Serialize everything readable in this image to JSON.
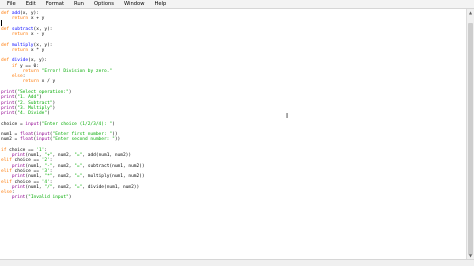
{
  "menu": [
    "File",
    "Edit",
    "Format",
    "Run",
    "Options",
    "Window",
    "Help"
  ],
  "code_lines": [
    [
      [
        "kw",
        "def "
      ],
      [
        "def",
        "add"
      ],
      [
        "txt",
        "(x, y):"
      ]
    ],
    [
      [
        "txt",
        "    "
      ],
      [
        "kw",
        "return"
      ],
      [
        "txt",
        " x + y"
      ]
    ],
    [],
    [
      [
        "kw",
        "def "
      ],
      [
        "def",
        "subtract"
      ],
      [
        "txt",
        "(x, y):"
      ]
    ],
    [
      [
        "txt",
        "    "
      ],
      [
        "kw",
        "return"
      ],
      [
        "txt",
        " x - y"
      ]
    ],
    [],
    [
      [
        "kw",
        "def "
      ],
      [
        "def",
        "multiply"
      ],
      [
        "txt",
        "(x, y):"
      ]
    ],
    [
      [
        "txt",
        "    "
      ],
      [
        "kw",
        "return"
      ],
      [
        "txt",
        " x * y"
      ]
    ],
    [],
    [
      [
        "kw",
        "def "
      ],
      [
        "def",
        "divide"
      ],
      [
        "txt",
        "(x, y):"
      ]
    ],
    [
      [
        "txt",
        "    "
      ],
      [
        "kw",
        "if"
      ],
      [
        "txt",
        " y == 0:"
      ]
    ],
    [
      [
        "txt",
        "        "
      ],
      [
        "kw",
        "return"
      ],
      [
        "txt",
        " "
      ],
      [
        "str",
        "\"Error! Division by zero.\""
      ]
    ],
    [
      [
        "txt",
        "    "
      ],
      [
        "kw",
        "else"
      ],
      [
        "txt",
        ":"
      ]
    ],
    [
      [
        "txt",
        "        "
      ],
      [
        "kw",
        "return"
      ],
      [
        "txt",
        " x / y"
      ]
    ],
    [],
    [
      [
        "bi",
        "print"
      ],
      [
        "txt",
        "("
      ],
      [
        "str",
        "\"Select operation:\""
      ],
      [
        "txt",
        ")"
      ]
    ],
    [
      [
        "bi",
        "print"
      ],
      [
        "txt",
        "("
      ],
      [
        "str",
        "\"1. Add\""
      ],
      [
        "txt",
        ")"
      ]
    ],
    [
      [
        "bi",
        "print"
      ],
      [
        "txt",
        "("
      ],
      [
        "str",
        "\"2. Subtract\""
      ],
      [
        "txt",
        ")"
      ]
    ],
    [
      [
        "bi",
        "print"
      ],
      [
        "txt",
        "("
      ],
      [
        "str",
        "\"3. Multiply\""
      ],
      [
        "txt",
        ")"
      ]
    ],
    [
      [
        "bi",
        "print"
      ],
      [
        "txt",
        "("
      ],
      [
        "str",
        "\"4. Divide\""
      ],
      [
        "txt",
        ")"
      ]
    ],
    [],
    [
      [
        "txt",
        "choice = "
      ],
      [
        "bi",
        "input"
      ],
      [
        "txt",
        "("
      ],
      [
        "str",
        "\"Enter choice (1/2/3/4): \""
      ],
      [
        "txt",
        ")"
      ]
    ],
    [],
    [
      [
        "txt",
        "num1 = "
      ],
      [
        "bi",
        "float"
      ],
      [
        "txt",
        "("
      ],
      [
        "bi",
        "input"
      ],
      [
        "txt",
        "("
      ],
      [
        "str",
        "\"Enter first number: \""
      ],
      [
        "txt",
        "))"
      ]
    ],
    [
      [
        "txt",
        "num2 = "
      ],
      [
        "bi",
        "float"
      ],
      [
        "txt",
        "("
      ],
      [
        "bi",
        "input"
      ],
      [
        "txt",
        "("
      ],
      [
        "str",
        "\"Enter second number: \""
      ],
      [
        "txt",
        "))"
      ]
    ],
    [],
    [
      [
        "kw",
        "if"
      ],
      [
        "txt",
        " choice == "
      ],
      [
        "str",
        "'1'"
      ],
      [
        "txt",
        ":"
      ]
    ],
    [
      [
        "txt",
        "    "
      ],
      [
        "bi",
        "print"
      ],
      [
        "txt",
        "(num1, "
      ],
      [
        "str",
        "\"+\""
      ],
      [
        "txt",
        ", num2, "
      ],
      [
        "str",
        "\"=\""
      ],
      [
        "txt",
        ", add(num1, num2))"
      ]
    ],
    [
      [
        "kw",
        "elif"
      ],
      [
        "txt",
        " choice == "
      ],
      [
        "str",
        "'2'"
      ],
      [
        "txt",
        ":"
      ]
    ],
    [
      [
        "txt",
        "    "
      ],
      [
        "bi",
        "print"
      ],
      [
        "txt",
        "(num1, "
      ],
      [
        "str",
        "\"-\""
      ],
      [
        "txt",
        ", num2, "
      ],
      [
        "str",
        "\"=\""
      ],
      [
        "txt",
        ", subtract(num1, num2))"
      ]
    ],
    [
      [
        "kw",
        "elif"
      ],
      [
        "txt",
        " choice == "
      ],
      [
        "str",
        "'3'"
      ],
      [
        "txt",
        ":"
      ]
    ],
    [
      [
        "txt",
        "    "
      ],
      [
        "bi",
        "print"
      ],
      [
        "txt",
        "(num1, "
      ],
      [
        "str",
        "\"*\""
      ],
      [
        "txt",
        ", num2, "
      ],
      [
        "str",
        "\"=\""
      ],
      [
        "txt",
        ", multiply(num1, num2))"
      ]
    ],
    [
      [
        "kw",
        "elif"
      ],
      [
        "txt",
        " choice == "
      ],
      [
        "str",
        "'4'"
      ],
      [
        "txt",
        ":"
      ]
    ],
    [
      [
        "txt",
        "    "
      ],
      [
        "bi",
        "print"
      ],
      [
        "txt",
        "(num1, "
      ],
      [
        "str",
        "\"/\""
      ],
      [
        "txt",
        ", num2, "
      ],
      [
        "str",
        "\"=\""
      ],
      [
        "txt",
        ", divide(num1, num2))"
      ]
    ],
    [
      [
        "kw",
        "else"
      ],
      [
        "txt",
        ":"
      ]
    ],
    [
      [
        "txt",
        "    "
      ],
      [
        "bi",
        "print"
      ],
      [
        "txt",
        "("
      ],
      [
        "str",
        "\"Invalid input\""
      ],
      [
        "txt",
        ")"
      ]
    ]
  ],
  "colors": {
    "keyword": "#ff7700",
    "definition": "#0000ff",
    "string": "#00aa00",
    "builtin": "#900090",
    "text": "#000000"
  },
  "icons": {
    "scroll_up": "scroll-up-arrow-icon",
    "scroll_down": "scroll-down-arrow-icon",
    "pointer": "text-cursor-icon"
  }
}
